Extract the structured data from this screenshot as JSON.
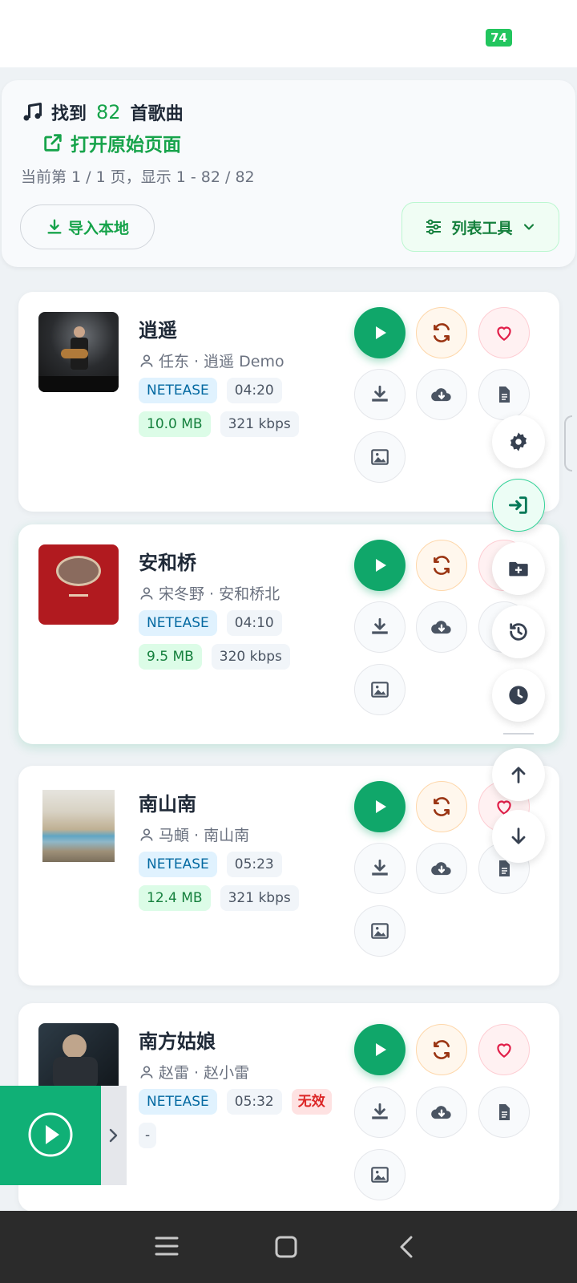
{
  "status_bar": {
    "battery": "74"
  },
  "summary": {
    "found_prefix": "找到",
    "count": "82",
    "found_suffix": "首歌曲",
    "open_original": "打开原始页面",
    "page_info": "当前第 1 / 1 页，显示 1 - 82 / 82",
    "import_label": "导入本地",
    "tools_label": "列表工具"
  },
  "songs": [
    {
      "title": "逍遥",
      "artist_line": "任东 · 逍遥 Demo",
      "source": "NETEASE",
      "duration": "04:20",
      "size": "10.0 MB",
      "bitrate": "321 kbps"
    },
    {
      "title": "安和桥",
      "artist_line": "宋冬野 · 安和桥北",
      "source": "NETEASE",
      "duration": "04:10",
      "size": "9.5 MB",
      "bitrate": "320 kbps"
    },
    {
      "title": "南山南",
      "artist_line": "马頔 · 南山南",
      "source": "NETEASE",
      "duration": "05:23",
      "size": "12.4 MB",
      "bitrate": "321 kbps"
    },
    {
      "title": "南方姑娘",
      "artist_line": "赵雷 · 赵小雷",
      "source": "NETEASE",
      "duration": "05:32",
      "status": "无效",
      "size": "-"
    }
  ],
  "colors": {
    "accent": "#10a76a",
    "link": "#16a34a",
    "danger": "#dc2626"
  }
}
